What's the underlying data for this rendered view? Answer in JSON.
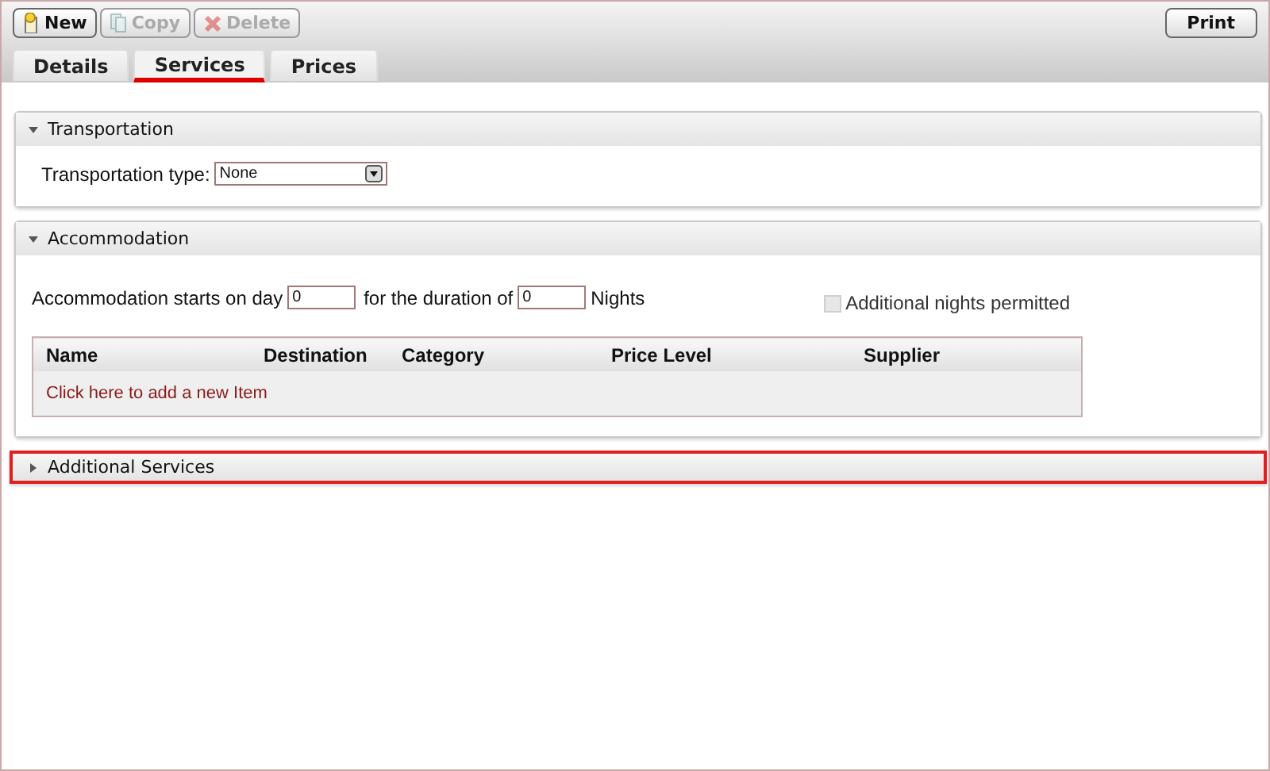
{
  "toolbar": {
    "buttons": [
      {
        "kind": "new",
        "label": "New",
        "disabled": false
      },
      {
        "kind": "copy",
        "label": "Copy",
        "disabled": true
      },
      {
        "kind": "delete",
        "label": "Delete",
        "disabled": true
      }
    ],
    "print_button": "Print"
  },
  "tabs": [
    {
      "label": "Details",
      "selected": false
    },
    {
      "label": "Services",
      "selected": true
    },
    {
      "label": "Prices",
      "selected": false
    }
  ],
  "sections": [
    {
      "kind": "transport",
      "title": "Transportation",
      "expanded": true,
      "highlighted": false,
      "field_label": "Transportation type:",
      "value": "None"
    },
    {
      "kind": "accommodation",
      "title": "Accommodation",
      "expanded": true,
      "highlighted": false,
      "start_label": "Accommodation starts on day",
      "start_value": "0",
      "duration_label": "for the duration of",
      "duration_value": "0",
      "unit": "Nights",
      "checkbox": {
        "label": "Additional nights permitted",
        "checked": false,
        "disabled": true
      },
      "table": {
        "columns": [
          "Name",
          "Destination",
          "Category",
          "Price Level",
          "Supplier"
        ],
        "add_link": "Click here to add a new Item"
      }
    },
    {
      "title": "Additional Services",
      "expanded": false,
      "highlighted": true
    }
  ]
}
